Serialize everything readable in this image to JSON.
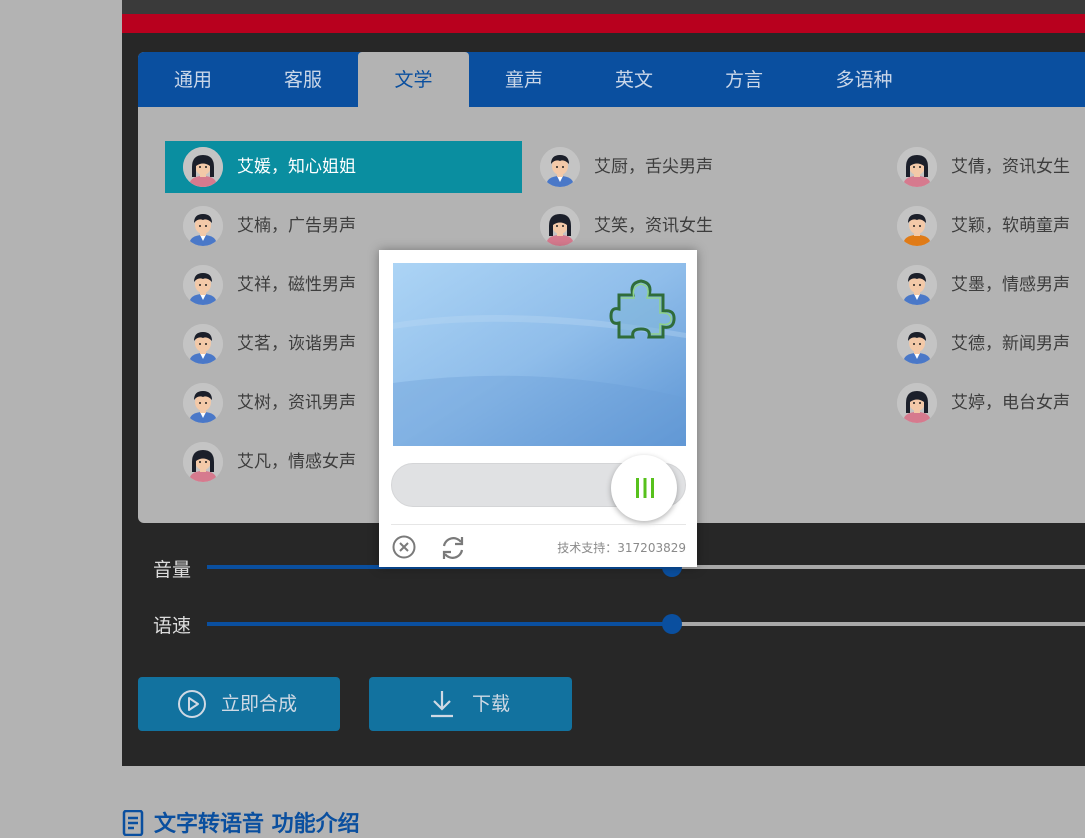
{
  "tabs": [
    {
      "label": "通用"
    },
    {
      "label": "客服"
    },
    {
      "label": "文学"
    },
    {
      "label": "童声"
    },
    {
      "label": "英文"
    },
    {
      "label": "方言"
    },
    {
      "label": "多语种"
    }
  ],
  "active_tab": "文学",
  "voices": [
    {
      "label": "艾媛，知心姐姐",
      "avatar": "female",
      "selected": true
    },
    {
      "label": "艾厨，舌尖男声",
      "avatar": "male"
    },
    {
      "label": "艾倩，资讯女生",
      "avatar": "female"
    },
    {
      "label": "艾楠，广告男声",
      "avatar": "male"
    },
    {
      "label": "艾笑，资讯女生",
      "avatar": "female"
    },
    {
      "label": "艾颖，软萌童声",
      "avatar": "child"
    },
    {
      "label": "艾祥，磁性男声",
      "avatar": "male"
    },
    {
      "label": "声",
      "avatar": "none"
    },
    {
      "label": "艾墨，情感男声",
      "avatar": "male"
    },
    {
      "label": "艾茗，诙谐男声",
      "avatar": "male"
    },
    {
      "label": "声",
      "avatar": "none"
    },
    {
      "label": "艾德，新闻男声",
      "avatar": "male"
    },
    {
      "label": "艾树，资讯男声",
      "avatar": "male"
    },
    {
      "label": "声",
      "avatar": "none"
    },
    {
      "label": "艾婷，电台女声",
      "avatar": "female"
    },
    {
      "label": "艾凡，情感女声",
      "avatar": "female"
    }
  ],
  "sliders": {
    "volume": {
      "label": "音量",
      "value_percent": 53
    },
    "speed": {
      "label": "语速",
      "value_percent": 53
    }
  },
  "buttons": {
    "synthesize": "立即合成",
    "download": "下载"
  },
  "section_title": "文字转语音 功能介绍",
  "captcha": {
    "support_text": "技术支持：317203829",
    "slider_position_percent": 86
  },
  "colors": {
    "brand_blue": "#0a4f9f",
    "selected_teal": "#0a8ea0",
    "red_bar": "#b8001e",
    "button_blue": "#12729f",
    "panel_dark": "#272727",
    "captcha_green": "#57c11c"
  }
}
